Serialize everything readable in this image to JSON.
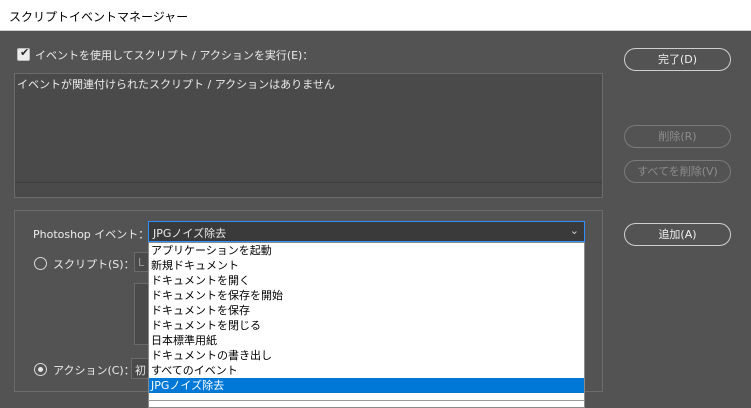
{
  "window": {
    "title": "スクリプトイベントマネージャー"
  },
  "enable_checkbox": {
    "label": "イベントを使用してスクリプト / アクションを実行(E)：",
    "checked": true
  },
  "event_list": {
    "empty_message": "イベントが関連付けられたスクリプト / アクションはありません"
  },
  "buttons": {
    "done": "完了(D)",
    "delete": "削除(R)",
    "delete_all": "すべてを削除(V)",
    "add": "追加(A)"
  },
  "event_form": {
    "photoshop_event_label": "Photoshop イベント：",
    "selected_event": "JPGノイズ除去",
    "script_radio_label": "スクリプト(S)：",
    "script_select_partial": "L",
    "action_radio_label": "アクション(C)：",
    "action_select_partial": "初"
  },
  "dropdown_options": [
    "アプリケーションを起動",
    "新規ドキュメント",
    "ドキュメントを開く",
    "ドキュメントを保存を開始",
    "ドキュメントを保存",
    "ドキュメントを閉じる",
    "日本標準用紙",
    "ドキュメントの書き出し",
    "すべてのイベント",
    "JPGノイズ除去"
  ],
  "dropdown_selected_index": 9,
  "icons": {
    "checkbox": "checkmark-icon",
    "select": "chevron-down-icon"
  }
}
